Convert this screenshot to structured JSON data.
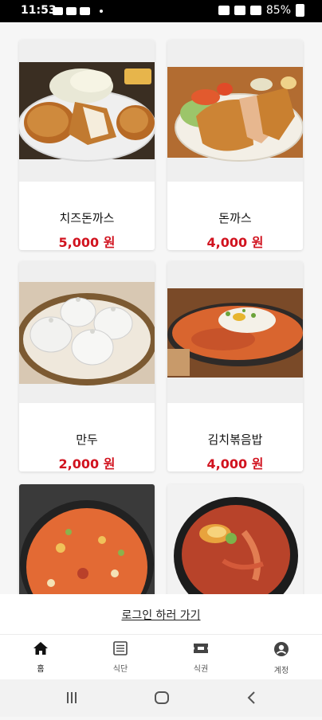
{
  "status_bar": {
    "time": "11:53",
    "battery": "85%"
  },
  "menu_items": [
    {
      "name": "치즈돈까스",
      "price": "5,000 원"
    },
    {
      "name": "돈까스",
      "price": "4,000 원"
    },
    {
      "name": "만두",
      "price": "2,000 원"
    },
    {
      "name": "김치볶음밥",
      "price": "4,000 원"
    },
    {
      "name": "",
      "price": ""
    },
    {
      "name": "",
      "price": ""
    }
  ],
  "login": {
    "link_label": "로그인 하러 가기"
  },
  "bottom_nav": {
    "items": [
      {
        "label": "홈",
        "icon": "home-icon",
        "active": true
      },
      {
        "label": "식단",
        "icon": "menu-list-icon",
        "active": false
      },
      {
        "label": "식권",
        "icon": "ticket-icon",
        "active": false
      },
      {
        "label": "계정",
        "icon": "account-icon",
        "active": false
      }
    ]
  },
  "colors": {
    "price": "#d1131f",
    "background": "#f6f6f6"
  }
}
